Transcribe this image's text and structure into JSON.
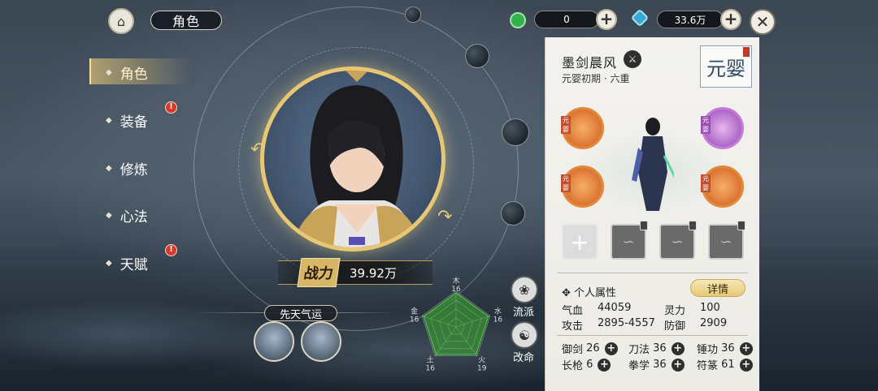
{
  "header": {
    "title": "角色",
    "currency1_value": "0",
    "currency2_value": "33.6万"
  },
  "nav": {
    "items": [
      {
        "label": "角色",
        "active": true,
        "badge": false
      },
      {
        "label": "装备",
        "active": false,
        "badge": true
      },
      {
        "label": "修炼",
        "active": false,
        "badge": false
      },
      {
        "label": "心法",
        "active": false,
        "badge": false
      },
      {
        "label": "天赋",
        "active": false,
        "badge": true
      }
    ],
    "badge_text": "!"
  },
  "portrait": {
    "power_label": "战力",
    "power_value": "39.92万"
  },
  "luck": {
    "label": "先天气运"
  },
  "radar": {
    "labels": [
      "木",
      "水",
      "火",
      "土",
      "金"
    ],
    "values": [
      "16",
      "16",
      "19",
      "16",
      "16"
    ]
  },
  "side_buttons": {
    "school_label": "流派",
    "fate_label": "改命"
  },
  "character": {
    "name": "墨剑晨风",
    "realm_line": "元婴初期 · 六重",
    "realm_stamp": "元婴",
    "skill_tag": "元婴"
  },
  "attributes": {
    "section_title": "个人属性",
    "detail_button": "详情",
    "stats": [
      {
        "label": "气血",
        "value": "44059"
      },
      {
        "label": "灵力",
        "value": "100"
      },
      {
        "label": "攻击",
        "value": "2895-4557"
      },
      {
        "label": "防御",
        "value": "2909"
      }
    ],
    "skills": [
      {
        "label": "御剑",
        "value": "26"
      },
      {
        "label": "刀法",
        "value": "36"
      },
      {
        "label": "锤功",
        "value": "36"
      },
      {
        "label": "长枪",
        "value": "6"
      },
      {
        "label": "拳学",
        "value": "36"
      },
      {
        "label": "符篆",
        "value": "61"
      }
    ]
  },
  "colors": {
    "gold_accent": "#e8c774",
    "badge_red": "#d63a2c",
    "panel_bg": "#f3f2ee",
    "radar_green": "#3fae3a"
  }
}
